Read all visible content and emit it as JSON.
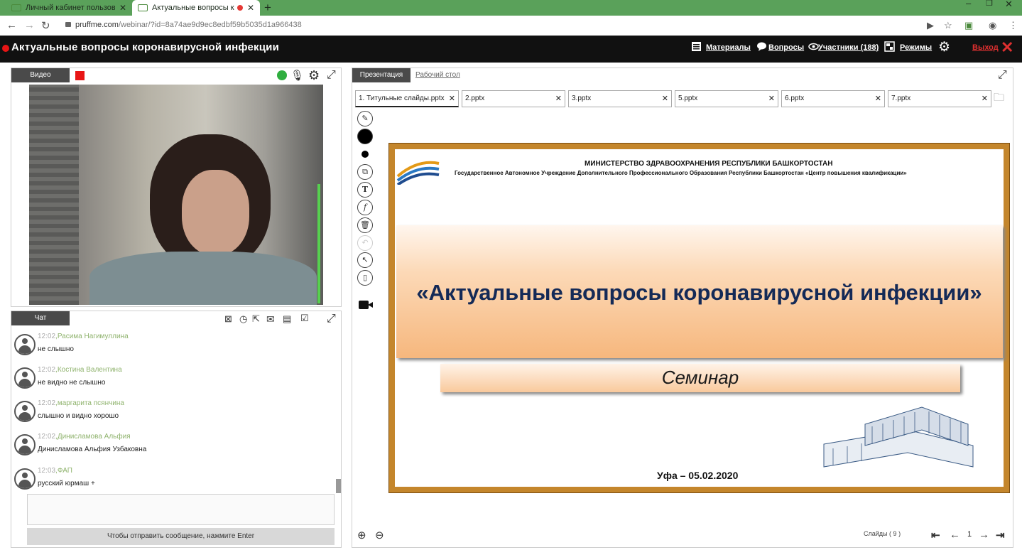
{
  "browser": {
    "tabs": [
      {
        "label": "Личный кабинет пользователя"
      },
      {
        "label": "Актуальные вопросы коронавирусной инфекции"
      }
    ],
    "url": {
      "domain": "pruffme.com",
      "path": "/webinar/?id=8a74ae9d9ec8edbf59b5035d1a966438"
    }
  },
  "app": {
    "title": "Актуальные вопросы коронавирусной инфекции",
    "menu": {
      "materials": "Материалы",
      "questions": "Вопросы",
      "participants": "Участники (188)",
      "modes": "Режимы",
      "exit": "Выход"
    }
  },
  "video_panel": {
    "tab": "Видео"
  },
  "chat_panel": {
    "tab": "Чат",
    "messages": [
      {
        "time": "12:02",
        "author": "Расима Нагимуллина",
        "text": "не слышно"
      },
      {
        "time": "12:02",
        "author": "Костина Валентина",
        "text": "не видно не слышно"
      },
      {
        "time": "12:02",
        "author": "маргарита псянчина",
        "text": "слышно и видно хорошо"
      },
      {
        "time": "12:02",
        "author": "Динисламова Альфия",
        "text": "Динисламова Альфия Узбаковна"
      },
      {
        "time": "12:03",
        "author": "ФАП",
        "text": "русский юрмаш +"
      }
    ],
    "send_hint": "Чтобы отправить сообщение, нажмите Enter"
  },
  "presentation_panel": {
    "tabs": [
      "Презентация",
      "Рабочий стол"
    ],
    "files": [
      "1. Титульные слайды.pptx",
      "2.pptx",
      "3.pptx",
      "5.pptx",
      "6.pptx",
      "7.pptx"
    ],
    "slide": {
      "ministry": "МИНИСТЕРСТВО ЗДРАВООХРАНЕНИЯ  РЕСПУБЛИКИ БАШКОРТОСТАН",
      "institution": "Государственное Автономное Учреждение Дополнительного Профессионального Образования Республики Башкортостан «Центр повышения квалификации»",
      "title": "«Актуальные вопросы коронавирусной инфекции»",
      "subtitle": "Семинар",
      "place_date": "Уфа – 05.02.2020"
    },
    "footer": {
      "slides_label": "Слайды (",
      "slides_count": "9",
      "slides_close": ")",
      "current_page": "1"
    }
  },
  "colors": {
    "live_red": "#e81515",
    "header_bg": "#111111",
    "chat_name": "#8fb36d",
    "exit_red": "#e03030"
  }
}
